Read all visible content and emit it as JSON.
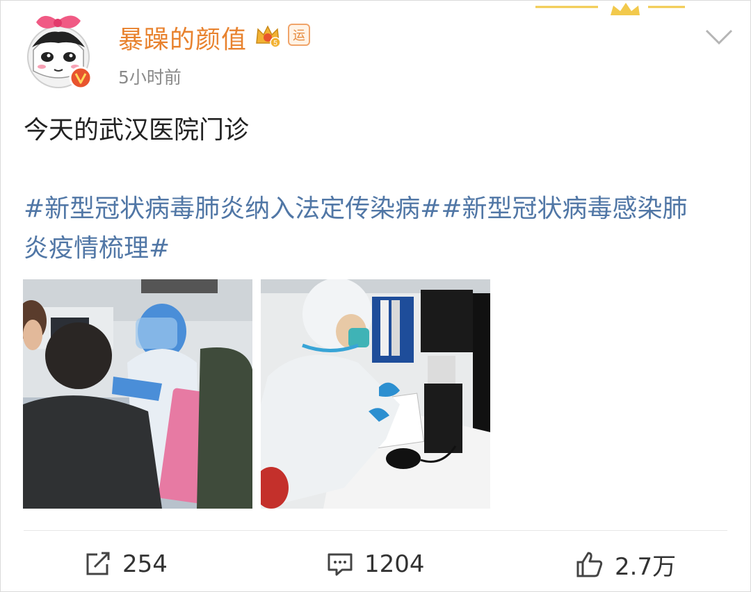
{
  "post": {
    "author": "暴躁的颜值",
    "time": "5小时前",
    "badge_yun": "运",
    "vip_level": "5",
    "text": "今天的武汉医院门诊",
    "hashtags": [
      "#新型冠状病毒肺炎纳入法定传染病#",
      "#新型冠状病毒感染肺炎疫情梳理#"
    ],
    "images": [
      {
        "icon": "photo-clinic-reception"
      },
      {
        "icon": "photo-doctor-at-desk"
      }
    ]
  },
  "actions": {
    "repost": {
      "icon": "repost-icon",
      "count": "254"
    },
    "comment": {
      "icon": "comment-icon",
      "count": "1204"
    },
    "like": {
      "icon": "thumbs-up-icon",
      "count": "2.7万"
    }
  },
  "colors": {
    "username": "#e8822e",
    "hashtag": "#5177a6",
    "timestamp": "#8a8a8a",
    "verified": "#e8542e"
  }
}
